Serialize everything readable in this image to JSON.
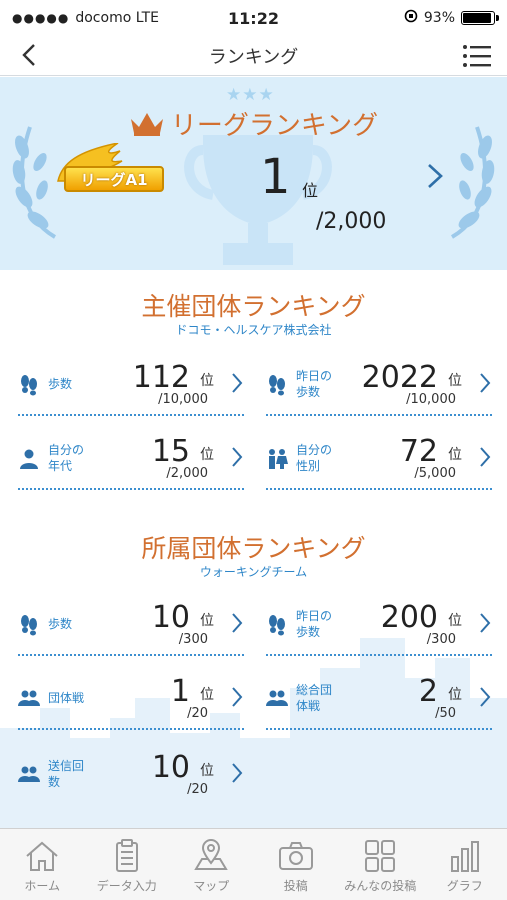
{
  "status_bar": {
    "signal": "●●●●●",
    "carrier": "docomo LTE",
    "time": "11:22",
    "battery": "93%",
    "battery_level": 0.93
  },
  "nav": {
    "title": "ランキング"
  },
  "league": {
    "title": "リーグランキング",
    "badge": "リーグA1",
    "rank": "1",
    "unit": "位",
    "total": "/2,000"
  },
  "host_org": {
    "title": "主催団体ランキング",
    "org_name": "ドコモ・ヘルスケア株式会社",
    "items": [
      {
        "label": "歩数",
        "value": "112",
        "unit": "位",
        "total": "/10,000",
        "icon": "footprints-icon"
      },
      {
        "label": "昨日の歩数",
        "value": "2022",
        "unit": "位",
        "total": "/10,000",
        "icon": "footprints-icon"
      },
      {
        "label": "自分の年代",
        "value": "15",
        "unit": "位",
        "total": "/2,000",
        "icon": "person-icon"
      },
      {
        "label": "自分の性別",
        "value": "72",
        "unit": "位",
        "total": "/5,000",
        "icon": "gender-icon"
      }
    ]
  },
  "member_org": {
    "title": "所属団体ランキング",
    "org_name": "ウォーキングチーム",
    "items": [
      {
        "label": "歩数",
        "value": "10",
        "unit": "位",
        "total": "/300",
        "icon": "footprints-icon"
      },
      {
        "label": "昨日の歩数",
        "value": "200",
        "unit": "位",
        "total": "/300",
        "icon": "footprints-icon"
      },
      {
        "label": "団体戦",
        "value": "1",
        "unit": "位",
        "total": "/20",
        "icon": "group-icon"
      },
      {
        "label": "総合団体戦",
        "value": "2",
        "unit": "位",
        "total": "/50",
        "icon": "group-icon"
      },
      {
        "label": "送信回数",
        "value": "10",
        "unit": "位",
        "total": "/20",
        "icon": "group-icon"
      }
    ]
  },
  "tabs": [
    {
      "label": "ホーム",
      "icon": "home-icon"
    },
    {
      "label": "データ入力",
      "icon": "clipboard-icon"
    },
    {
      "label": "マップ",
      "icon": "map-pin-icon"
    },
    {
      "label": "投稿",
      "icon": "camera-icon"
    },
    {
      "label": "みんなの投稿",
      "icon": "grid-icon"
    },
    {
      "label": "グラフ",
      "icon": "bar-chart-icon"
    }
  ],
  "colors": {
    "accent_orange": "#d27030",
    "accent_blue": "#2e86c8",
    "league_bg": "#dbeefa",
    "badge_gold": "#f0b400"
  }
}
